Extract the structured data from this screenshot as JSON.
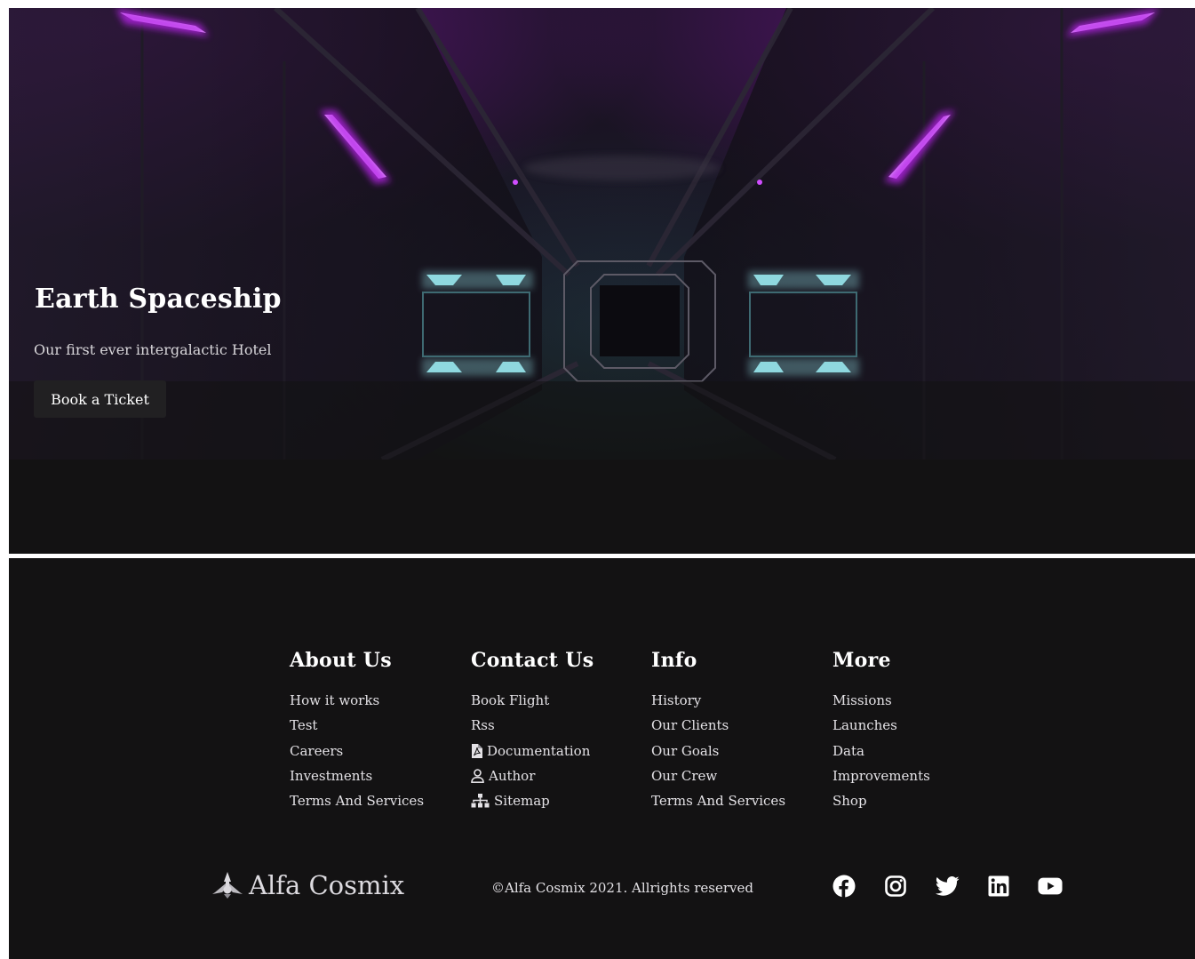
{
  "hero": {
    "title": "Earth Spaceship",
    "subtitle": "Our first ever intergalactic Hotel",
    "cta_label": "Book a Ticket"
  },
  "footer": {
    "columns": [
      {
        "title": "About Us",
        "links": [
          "How it works",
          "Test",
          "Careers",
          "Investments",
          "Terms And Services"
        ]
      },
      {
        "title": "Contact Us",
        "links": [
          "Book Flight",
          "Rss",
          "Documentation",
          "Author",
          "Sitemap"
        ],
        "icons": [
          "",
          "",
          "file-pdf-icon",
          "user-icon",
          "sitemap-icon"
        ]
      },
      {
        "title": "Info",
        "links": [
          "History",
          "Our Clients",
          "Our Goals",
          "Our Crew",
          "Terms And Services"
        ]
      },
      {
        "title": "More",
        "links": [
          "Missions",
          "Launches",
          "Data",
          "Improvements",
          "Shop"
        ]
      }
    ],
    "brand_name": "Alfa Cosmix",
    "copyright": "©Alfa Cosmix 2021. Allrights reserved",
    "socials": [
      "facebook-icon",
      "instagram-icon",
      "twitter-icon",
      "linkedin-icon",
      "youtube-icon"
    ]
  },
  "colors": {
    "background": "#131213",
    "accent_purple": "#a21fd6",
    "accent_teal": "#8fd8df"
  }
}
